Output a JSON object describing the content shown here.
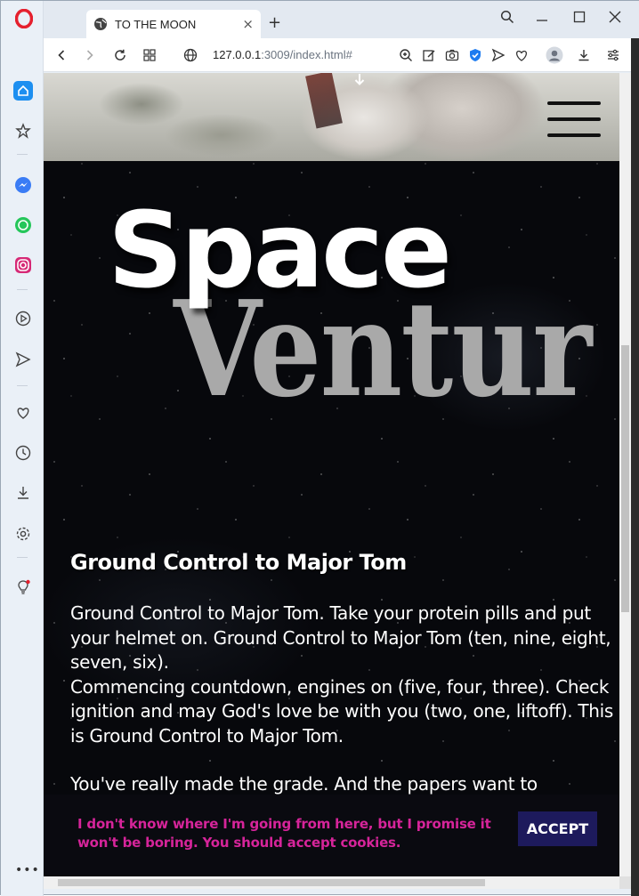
{
  "browser": {
    "tab_title": "TO THE MOON",
    "url_host": "127.0.0.1",
    "url_rest": ":3009/index.html#",
    "new_tab": "+",
    "tab_close": "×"
  },
  "page": {
    "title_line1": "Space",
    "title_line2": "Ventur",
    "article_heading": "Ground Control to Major Tom",
    "paragraph1": "Ground Control to Major Tom. Take your protein pills and put your helmet on. Ground Control to Major Tom (ten, nine, eight, seven, six).",
    "paragraph1b": "Commencing countdown, engines on (five, four, three). Check ignition and may God's love be with you (two, one, liftoff). This is Ground Control to Major Tom.",
    "paragraph2": "You've really made the grade. And the papers want to"
  },
  "cookie_banner": {
    "message": "I don't know where I'm going from here, but I promise it won't be boring. You should accept cookies.",
    "accept_label": "ACCEPT"
  },
  "colors": {
    "cookie_text": "#d6249a",
    "accept_bg": "#1d1a5c",
    "page_bg": "#07080c"
  }
}
